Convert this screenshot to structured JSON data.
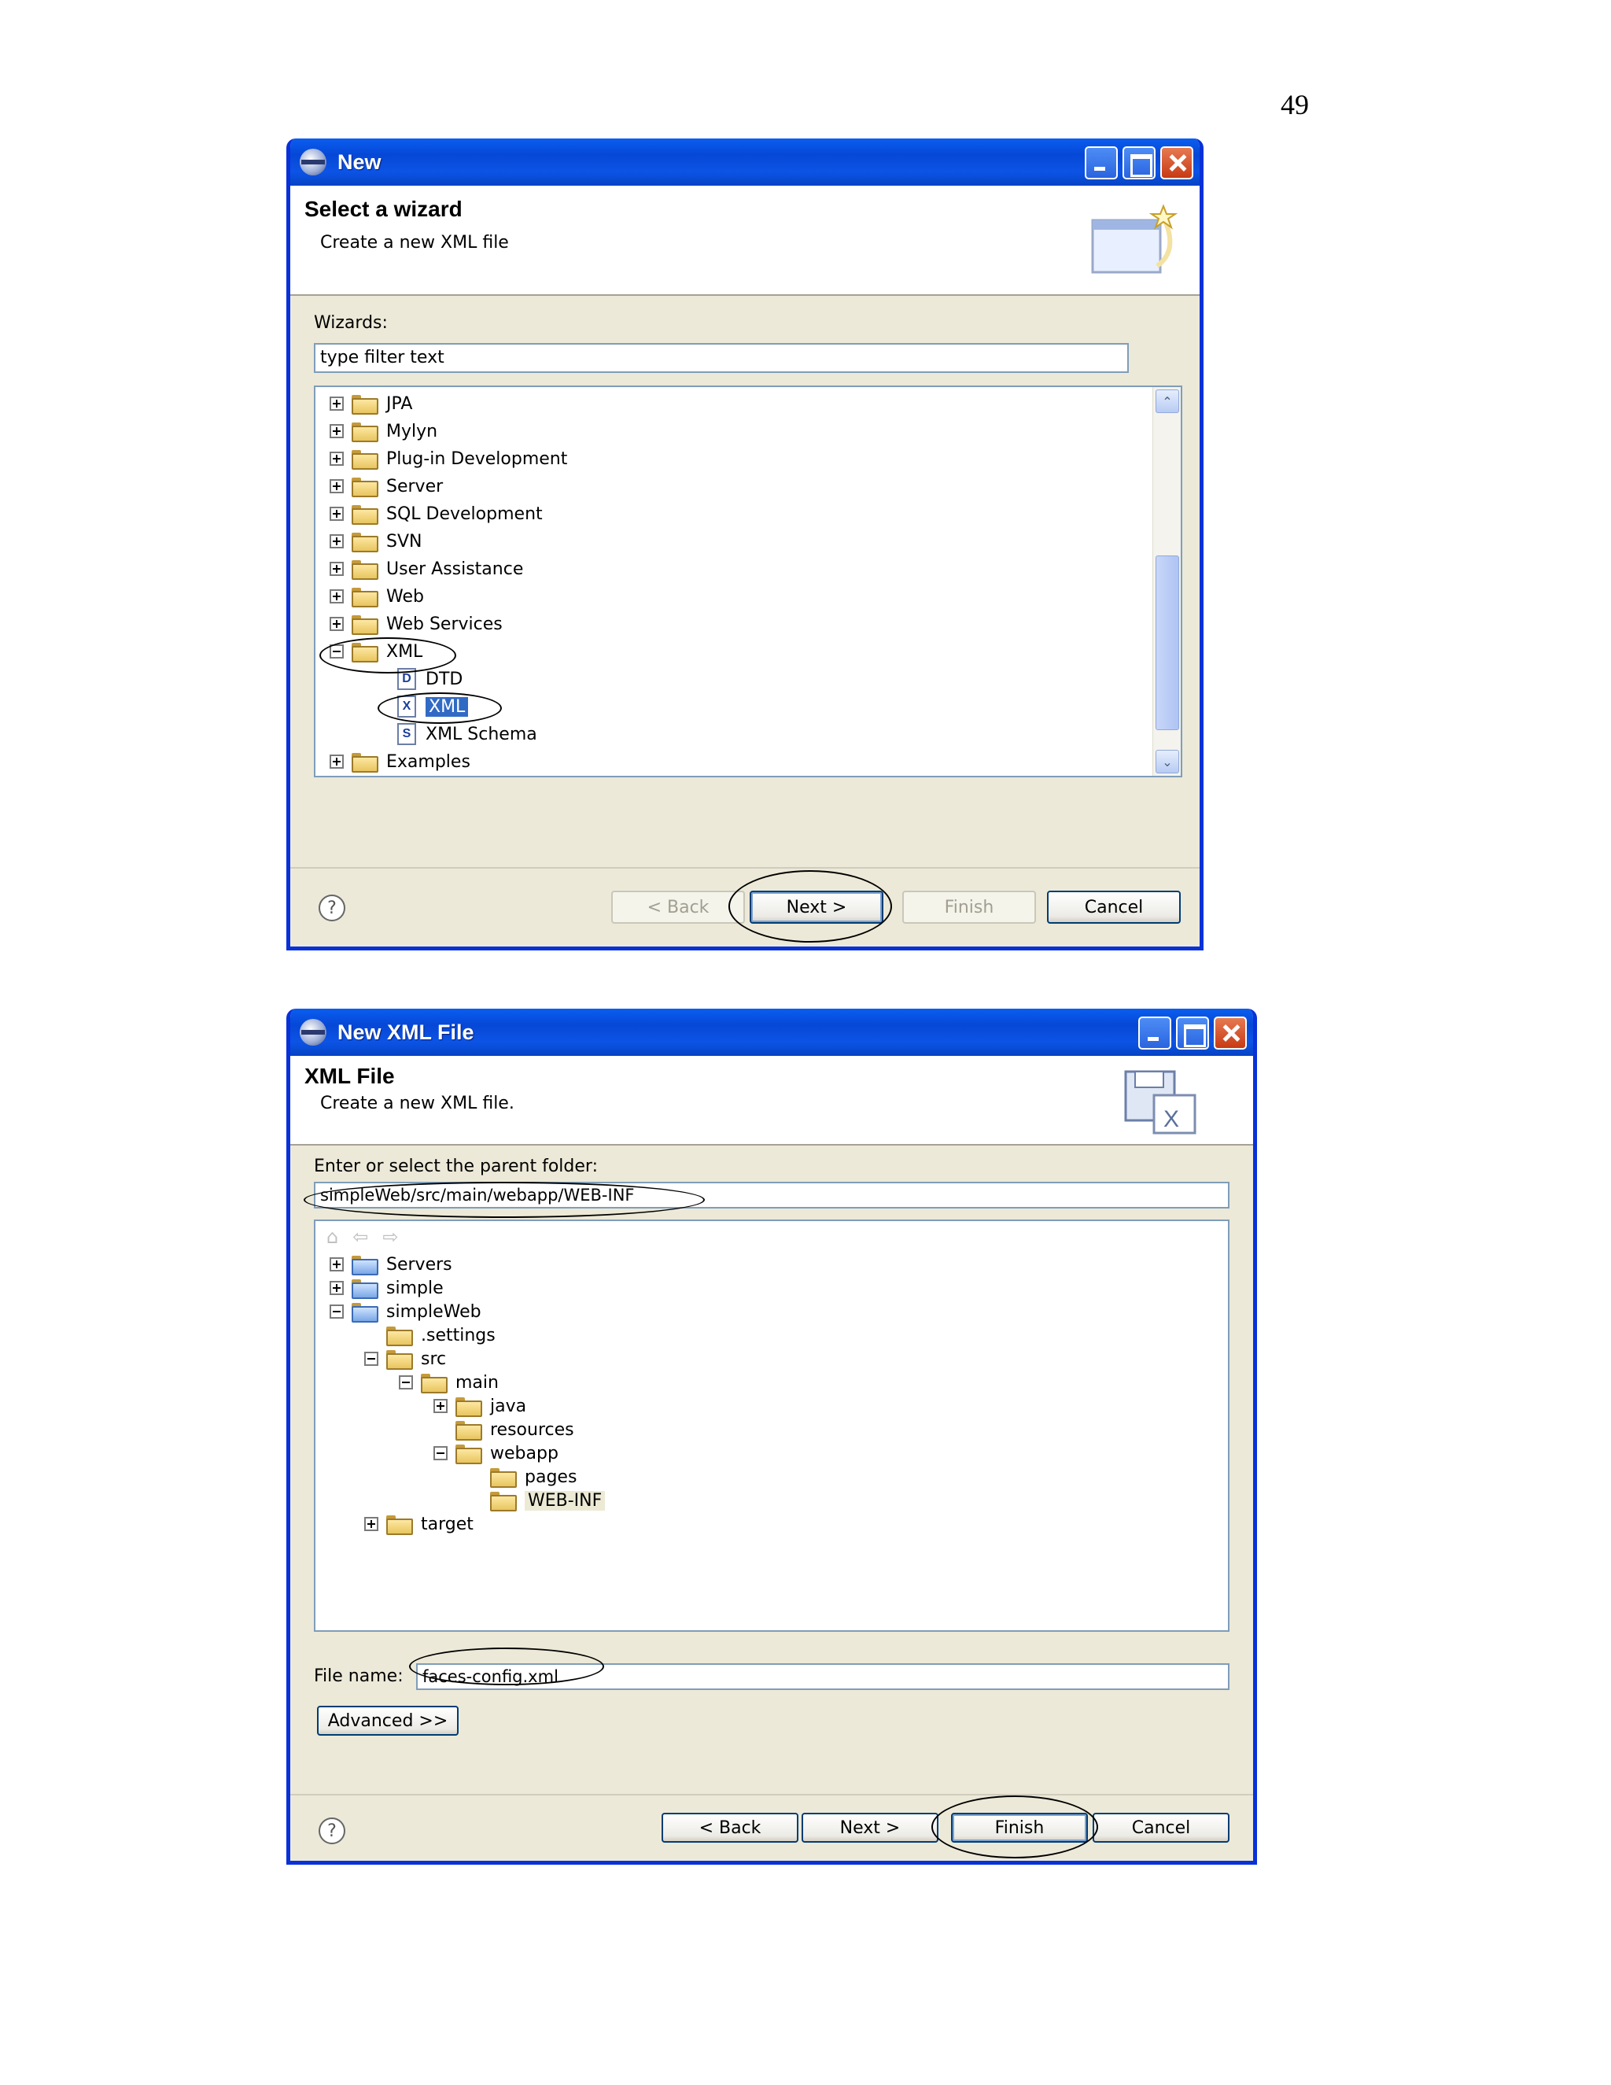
{
  "page_number": "49",
  "dialog1": {
    "title": "New",
    "header_title": "Select a wizard",
    "header_desc": "Create a new XML file",
    "wizards_label": "Wizards:",
    "filter_text": "type filter text",
    "tree": [
      {
        "label": "JPA",
        "icon": "folder-icon",
        "state": "collapsed"
      },
      {
        "label": "Mylyn",
        "icon": "folder-icon",
        "state": "collapsed"
      },
      {
        "label": "Plug-in Development",
        "icon": "folder-icon",
        "state": "collapsed"
      },
      {
        "label": "Server",
        "icon": "folder-icon",
        "state": "collapsed"
      },
      {
        "label": "SQL Development",
        "icon": "folder-icon",
        "state": "collapsed"
      },
      {
        "label": "SVN",
        "icon": "folder-icon",
        "state": "collapsed"
      },
      {
        "label": "User Assistance",
        "icon": "folder-icon",
        "state": "collapsed"
      },
      {
        "label": "Web",
        "icon": "folder-icon",
        "state": "collapsed"
      },
      {
        "label": "Web Services",
        "icon": "folder-icon",
        "state": "collapsed"
      },
      {
        "label": "XML",
        "icon": "folder-icon",
        "state": "expanded"
      },
      {
        "label": "DTD",
        "icon": "dtd-file-icon",
        "glyph": "D"
      },
      {
        "label": "XML",
        "icon": "xml-file-icon",
        "glyph": "X",
        "selected": true
      },
      {
        "label": "XML Schema",
        "icon": "schema-file-icon",
        "glyph": "S"
      },
      {
        "label": "Examples",
        "icon": "folder-icon",
        "state": "collapsed"
      }
    ],
    "buttons": {
      "back": "< Back",
      "next": "Next >",
      "finish": "Finish",
      "cancel": "Cancel"
    }
  },
  "dialog2": {
    "title": "New XML File",
    "header_title": "XML File",
    "header_desc": "Create a new XML file.",
    "folder_label": "Enter or select the parent folder:",
    "folder_value": "simpleWeb/src/main/webapp/WEB-INF",
    "nav_icons": [
      "home-icon",
      "back-arrow-icon",
      "forward-arrow-icon"
    ],
    "tree": [
      {
        "label": "Servers",
        "state": "collapsed",
        "project": true
      },
      {
        "label": "simple",
        "state": "collapsed",
        "project": true
      },
      {
        "label": "simpleWeb",
        "state": "expanded",
        "project": true
      },
      {
        "label": ".settings",
        "state": "leaf"
      },
      {
        "label": "src",
        "state": "expanded"
      },
      {
        "label": "main",
        "state": "expanded"
      },
      {
        "label": "java",
        "state": "collapsed"
      },
      {
        "label": "resources",
        "state": "leaf"
      },
      {
        "label": "webapp",
        "state": "expanded"
      },
      {
        "label": "pages",
        "state": "leaf"
      },
      {
        "label": "WEB-INF",
        "state": "leaf",
        "selected": true
      },
      {
        "label": "target",
        "state": "collapsed"
      }
    ],
    "file_name_label": "File name:",
    "file_name_value": "faces-config.xml",
    "advanced_button": "Advanced >>",
    "buttons": {
      "back": "< Back",
      "next": "Next >",
      "finish": "Finish",
      "cancel": "Cancel"
    }
  }
}
